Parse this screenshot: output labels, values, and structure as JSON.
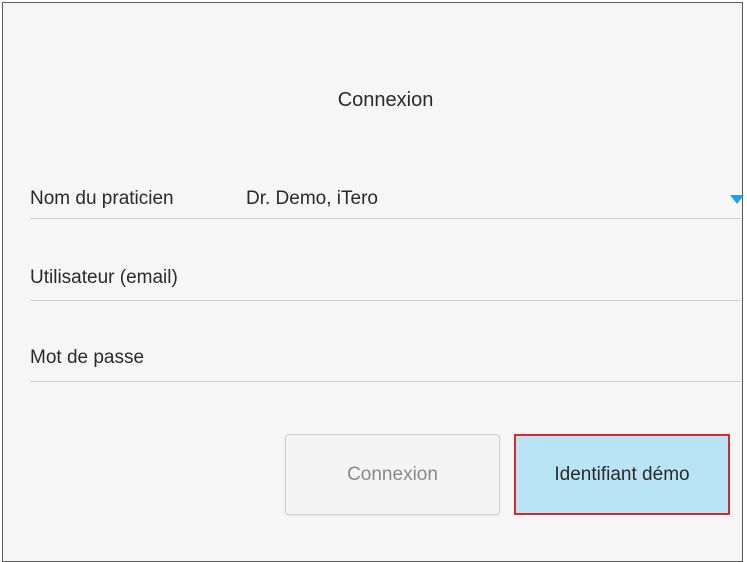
{
  "header": {
    "title": "Connexion"
  },
  "form": {
    "practitioner": {
      "label": "Nom du praticien",
      "value": "Dr. Demo, iTero"
    },
    "user": {
      "label": "Utilisateur (email)"
    },
    "password": {
      "label": "Mot de passe"
    }
  },
  "buttons": {
    "login_label": "Connexion",
    "demo_label": "Identifiant démo"
  },
  "colors": {
    "accent": "#1fa3e6",
    "demo_button_bg": "#b9e4f6",
    "demo_button_border": "#d9272e"
  }
}
